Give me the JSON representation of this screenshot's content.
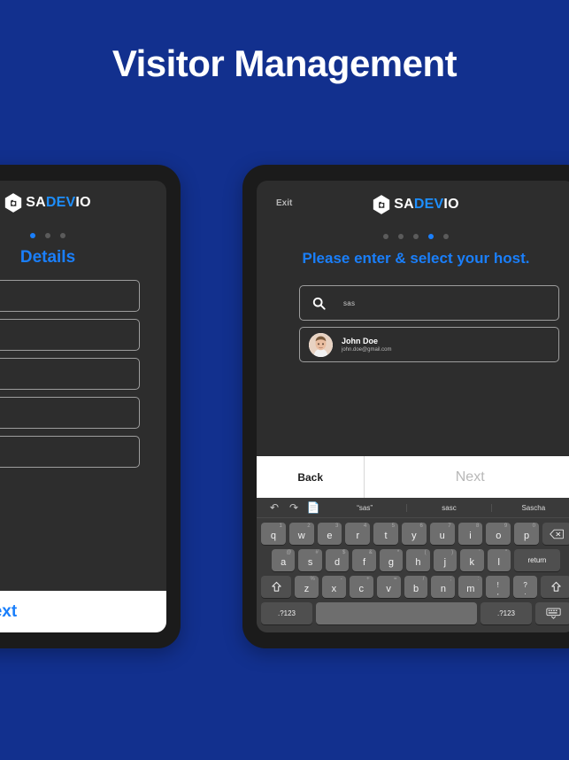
{
  "headline": "Visitor Management",
  "colors": {
    "background": "#12308e",
    "accent_blue": "#1a7ffb",
    "screen_dark": "#2d2d2d",
    "bezel": "#1b1b1b",
    "keyboard_bg": "#3a3a3a"
  },
  "left_tablet": {
    "logo": {
      "sa": "SA",
      "dev": "DEV",
      "io": "IO",
      "mark": "hexagon-logo-icon"
    },
    "dots": {
      "count": 3,
      "active_index": 0
    },
    "step_title": "Details",
    "fields": [
      {
        "value": "",
        "placeholder": ""
      },
      {
        "value": "",
        "placeholder": ""
      },
      {
        "value": "",
        "placeholder": ""
      },
      {
        "value": "",
        "placeholder": ""
      },
      {
        "value": "",
        "placeholder": ""
      }
    ],
    "next_label": "Next"
  },
  "right_tablet": {
    "exit_label": "Exit",
    "logo": {
      "sa": "SA",
      "dev": "DEV",
      "io": "IO",
      "mark": "hexagon-logo-icon"
    },
    "dots": {
      "count": 5,
      "active_index": 3
    },
    "step_title": "Please enter & select your host.",
    "search": {
      "value": "sas",
      "placeholder": "",
      "icon": "search-icon"
    },
    "results": [
      {
        "name": "John Doe",
        "email": "john.doe@gmail.com",
        "avatar": "user-photo-avatar"
      }
    ],
    "back_label": "Back",
    "next_label": "Next",
    "keyboard": {
      "tools": [
        "undo-icon",
        "redo-icon",
        "paste-icon"
      ],
      "suggestions": [
        "“sas”",
        "sasc",
        "Sascha"
      ],
      "row1": [
        {
          "main": "q",
          "alt": "1"
        },
        {
          "main": "w",
          "alt": "2"
        },
        {
          "main": "e",
          "alt": "3"
        },
        {
          "main": "r",
          "alt": "4"
        },
        {
          "main": "t",
          "alt": "5"
        },
        {
          "main": "y",
          "alt": "6"
        },
        {
          "main": "u",
          "alt": "7"
        },
        {
          "main": "i",
          "alt": "8"
        },
        {
          "main": "o",
          "alt": "9"
        },
        {
          "main": "p",
          "alt": "0"
        }
      ],
      "backspace": "backspace-icon",
      "row2": [
        {
          "main": "a",
          "alt": "@"
        },
        {
          "main": "s",
          "alt": "#"
        },
        {
          "main": "d",
          "alt": "$"
        },
        {
          "main": "f",
          "alt": "&"
        },
        {
          "main": "g",
          "alt": "*"
        },
        {
          "main": "h",
          "alt": "("
        },
        {
          "main": "j",
          "alt": ")"
        },
        {
          "main": "k",
          "alt": "'"
        },
        {
          "main": "l",
          "alt": "\""
        }
      ],
      "return_label": "return",
      "row3": [
        {
          "main": "z",
          "alt": "%"
        },
        {
          "main": "x",
          "alt": "-"
        },
        {
          "main": "c",
          "alt": "+"
        },
        {
          "main": "v",
          "alt": "="
        },
        {
          "main": "b",
          "alt": "/"
        },
        {
          "main": "n",
          "alt": ";"
        },
        {
          "main": "m",
          "alt": ":"
        }
      ],
      "punct_keys": [
        {
          "top": "!",
          "bot": ","
        },
        {
          "top": "?",
          "bot": "."
        }
      ],
      "shift_icon": "shift-icon",
      "numeric_label": ".?123",
      "space_label": "",
      "dismiss_icon": "hide-keyboard-icon"
    }
  }
}
